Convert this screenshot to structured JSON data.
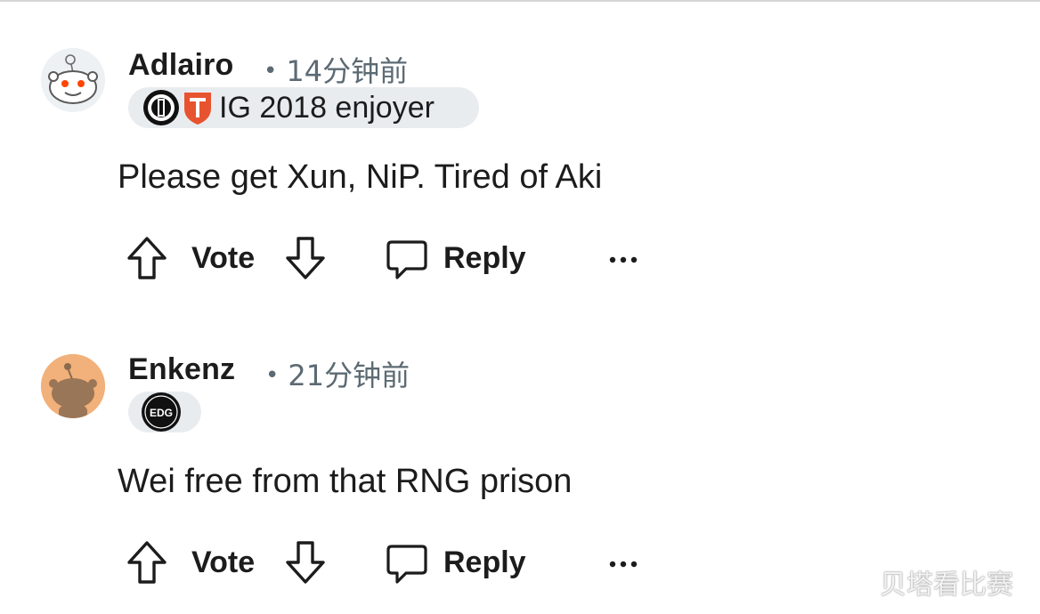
{
  "comments": [
    {
      "username": "Adlairo",
      "timestamp": "14分钟前",
      "flair_text": "IG 2018 enjoyer",
      "flair_icons": [
        "ig-team-logo-icon",
        "tes-team-logo-icon"
      ],
      "body": "Please get Xun, NiP. Tired of Aki",
      "actions": {
        "vote_label": "Vote",
        "reply_label": "Reply",
        "more_label": "···"
      }
    },
    {
      "username": "Enkenz",
      "timestamp": "21分钟前",
      "flair_text": "",
      "flair_icons": [
        "edg-team-logo-icon"
      ],
      "edg_logo_text": "EDG",
      "body": "Wei free from that RNG prison",
      "actions": {
        "vote_label": "Vote",
        "reply_label": "Reply",
        "more_label": "···"
      }
    }
  ],
  "separator": "•",
  "watermark": "贝塔看比赛",
  "colors": {
    "text": "#1c1c1c",
    "meta": "#5c6a73",
    "flair_bg": "#e9ecef",
    "tes_red": "#e8532f"
  }
}
